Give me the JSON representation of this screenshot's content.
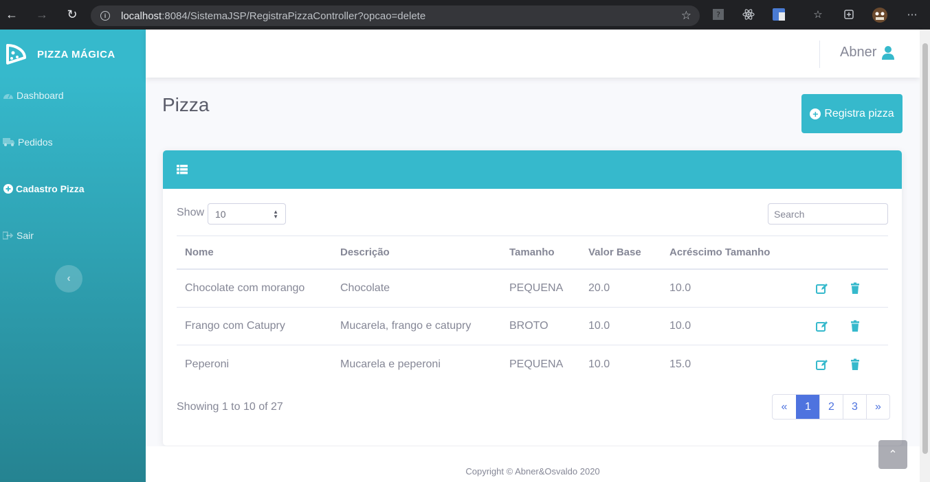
{
  "browser": {
    "url_host": "localhost",
    "url_rest": ":8084/SistemaJSP/RegistraPizzaController?opcao=delete"
  },
  "sidebar": {
    "brand": "PIZZA MÁGICA",
    "items": [
      {
        "label": "Dashboard",
        "icon": "tachometer-icon"
      },
      {
        "label": "Pedidos",
        "icon": "truck-icon"
      },
      {
        "label": "Cadastro Pizza",
        "icon": "plus-circle-icon"
      },
      {
        "label": "Sair",
        "icon": "sign-out-icon"
      }
    ],
    "toggle_icon": "chevron-left-icon"
  },
  "topbar": {
    "user_name": "Abner",
    "user_icon": "user-icon"
  },
  "page": {
    "title": "Pizza",
    "register_button": "Registra pizza"
  },
  "table_controls": {
    "show_label": "Show",
    "show_value": "10",
    "search_placeholder": "Search"
  },
  "table": {
    "headers": [
      "Nome",
      "Descrição",
      "Tamanho",
      "Valor Base",
      "Acréscimo Tamanho"
    ],
    "rows": [
      [
        "Chocolate com morango",
        "Chocolate",
        "PEQUENA",
        "20.0",
        "10.0"
      ],
      [
        "Frango com Catupry",
        "Mucarela, frango e catupry",
        "BROTO",
        "10.0",
        "10.0"
      ],
      [
        "Peperoni",
        "Mucarela e peperoni",
        "PEQUENA",
        "10.0",
        "15.0"
      ]
    ]
  },
  "pagination": {
    "info": "Showing 1 to 10 of 27",
    "prev": "«",
    "pages": [
      "1",
      "2",
      "3"
    ],
    "next": "»",
    "active_page": "1"
  },
  "footer": {
    "copyright": "Copyright © Abner&Osvaldo 2020"
  },
  "colors": {
    "accent": "#36b9cc",
    "primary": "#4e73df"
  }
}
